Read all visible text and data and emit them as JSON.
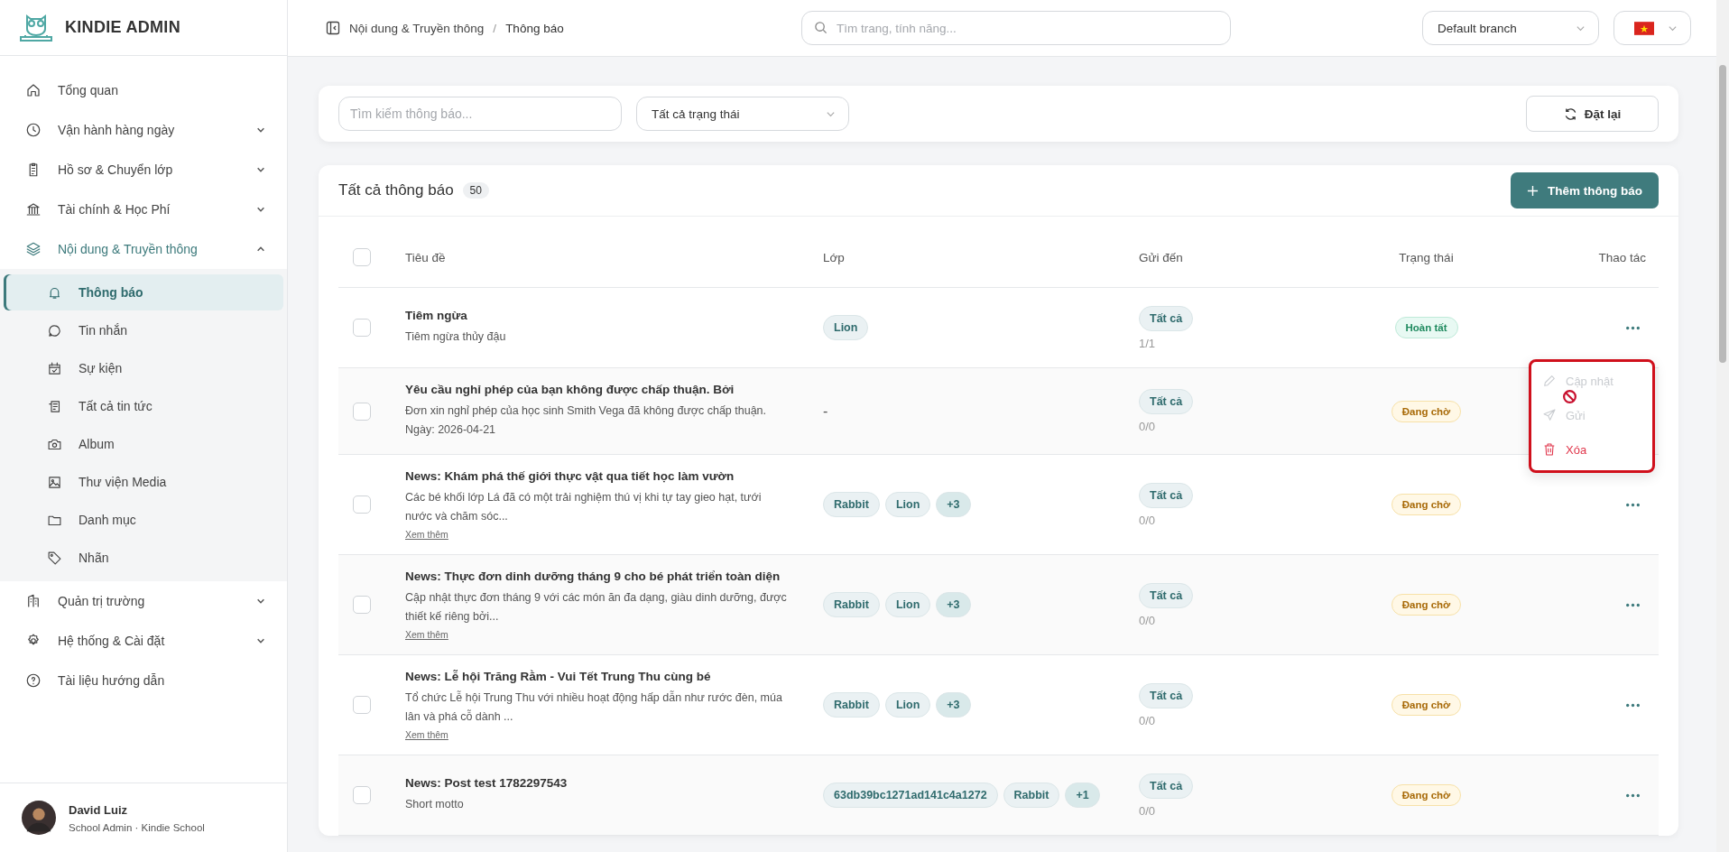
{
  "app": {
    "name": "KINDIE ADMIN"
  },
  "sidebar": {
    "items": [
      {
        "label": "Tổng quan",
        "selected": false
      },
      {
        "label": "Vận hành hàng ngày",
        "selected": false,
        "expanded": false
      },
      {
        "label": "Hồ sơ & Chuyển lớp",
        "selected": false,
        "expanded": false
      },
      {
        "label": "Tài chính & Học Phí",
        "selected": false,
        "expanded": false
      },
      {
        "label": "Nội dung & Truyền thông",
        "selected": true,
        "expanded": true,
        "children": [
          {
            "label": "Thông báo",
            "selected": true
          },
          {
            "label": "Tin nhắn",
            "selected": false
          },
          {
            "label": "Sự kiện",
            "selected": false
          },
          {
            "label": "Tất cả tin tức",
            "selected": false
          },
          {
            "label": "Album",
            "selected": false
          },
          {
            "label": "Thư viện Media",
            "selected": false
          },
          {
            "label": "Danh mục",
            "selected": false
          },
          {
            "label": "Nhãn",
            "selected": false
          }
        ]
      },
      {
        "label": "Quản trị trường",
        "selected": false,
        "expanded": false
      },
      {
        "label": "Hệ thống & Cài đặt",
        "selected": false,
        "expanded": false
      },
      {
        "label": "Tài liệu hướng dẫn",
        "selected": false
      }
    ],
    "user": {
      "name": "David Luiz",
      "role": "School Admin · Kindie School"
    }
  },
  "topbar": {
    "breadcrumb": [
      "Nội dung & Truyền thông",
      "Thông báo"
    ],
    "separator": "/",
    "search": {
      "placeholder": "Tìm trang, tính năng..."
    },
    "branch": "Default branch"
  },
  "filters": {
    "search": {
      "placeholder": "Tìm kiếm thông báo..."
    },
    "status": "Tất cả trạng thái",
    "reset": "Đặt lại"
  },
  "table": {
    "title": "Tất cả thông báo",
    "count": "50",
    "add_button": "Thêm thông báo",
    "columns": [
      "Tiêu đề",
      "Lớp",
      "Gửi đến",
      "Trạng thái",
      "Thao tác"
    ],
    "select_all_checked": false,
    "rows": [
      {
        "title": "Tiêm ngừa",
        "description": [
          "Tiêm ngừa thủy đậu"
        ],
        "classes": [
          {
            "label": "Lion",
            "kind": "class"
          }
        ],
        "recipients": "Tất cả",
        "sent": "1/1",
        "status": {
          "label": "Hoàn tất",
          "kind": "done"
        },
        "checked": false
      },
      {
        "title": "Yêu cầu nghỉ phép của bạn không được chấp thuận. Bởi",
        "description": [
          "Đơn xin nghỉ phép của học sinh Smith Vega đã không được chấp thuận.",
          "Ngày: 2026-04-21"
        ],
        "classes_empty": "-",
        "recipients": "Tất cả",
        "sent": "0/0",
        "status": {
          "label": "Đang chờ",
          "kind": "pending"
        },
        "checked": false,
        "menu": {
          "items": [
            {
              "label": "Cập nhật",
              "kind": "edit",
              "disabled": true
            },
            {
              "label": "Gửi",
              "kind": "send",
              "disabled": true
            },
            {
              "label": "Xóa",
              "kind": "delete",
              "disabled": false
            }
          ]
        }
      },
      {
        "title": "News: Khám phá thế giới thực vật qua tiết học làm vườn",
        "description": [
          "Các bé khối lớp Lá đã có một trải nghiệm thú vị khi tự tay gieo hạt, tưới",
          "nước và chăm sóc..."
        ],
        "more": "Xem thêm",
        "classes": [
          {
            "label": "Rabbit",
            "kind": "class"
          },
          {
            "label": "Lion",
            "kind": "class"
          },
          {
            "label": "+3",
            "kind": "more"
          }
        ],
        "recipients": "Tất cả",
        "sent": "0/0",
        "status": {
          "label": "Đang chờ",
          "kind": "pending"
        },
        "checked": false
      },
      {
        "title": "News: Thực đơn dinh dưỡng tháng 9 cho bé phát triển toàn diện",
        "description": [
          "Cập nhật thực đơn tháng 9 với các món ăn đa dạng, giàu dinh dưỡng, được",
          "thiết kế riêng bởi..."
        ],
        "more": "Xem thêm",
        "classes": [
          {
            "label": "Rabbit",
            "kind": "class"
          },
          {
            "label": "Lion",
            "kind": "class"
          },
          {
            "label": "+3",
            "kind": "more"
          }
        ],
        "recipients": "Tất cả",
        "sent": "0/0",
        "status": {
          "label": "Đang chờ",
          "kind": "pending"
        },
        "checked": false
      },
      {
        "title": "News: Lễ hội Trăng Rằm - Vui Tết Trung Thu cùng bé",
        "description": [
          "Tổ chức Lễ hội Trung Thu với nhiều hoạt động hấp dẫn như rước đèn, múa",
          "lân và phá cỗ dành ..."
        ],
        "more": "Xem thêm",
        "classes": [
          {
            "label": "Rabbit",
            "kind": "class"
          },
          {
            "label": "Lion",
            "kind": "class"
          },
          {
            "label": "+3",
            "kind": "more"
          }
        ],
        "recipients": "Tất cả",
        "sent": "0/0",
        "status": {
          "label": "Đang chờ",
          "kind": "pending"
        },
        "checked": false
      },
      {
        "title": "News: Post test 1782297543",
        "description": [
          "Short motto"
        ],
        "classes": [
          {
            "label": "63db39bc1271ad141c4a1272",
            "kind": "class"
          },
          {
            "label": "Rabbit",
            "kind": "class"
          },
          {
            "label": "+1",
            "kind": "more"
          }
        ],
        "recipients": "Tất cả",
        "sent": "0/0",
        "status": {
          "label": "Đang chờ",
          "kind": "pending"
        },
        "checked": false
      }
    ]
  }
}
